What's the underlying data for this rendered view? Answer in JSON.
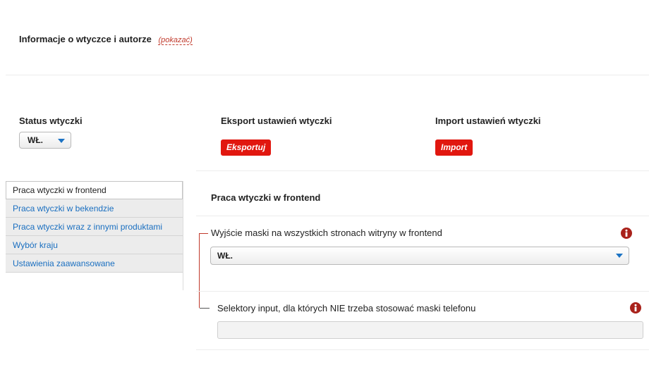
{
  "plugin_info": {
    "title": "Informacje o wtyczce i autorze",
    "toggle_link": "(pokazać)"
  },
  "status": {
    "label": "Status wtyczki",
    "selected": "WŁ."
  },
  "export": {
    "label": "Eksport ustawień wtyczki",
    "button": "Eksportuj"
  },
  "import": {
    "label": "Import ustawień wtyczki",
    "button": "Import"
  },
  "sidebar": {
    "items": [
      {
        "label": "Praca wtyczki w frontend",
        "active": true
      },
      {
        "label": "Praca wtyczki w bekendzie",
        "active": false
      },
      {
        "label": "Praca wtyczki wraz z innymi produktami",
        "active": false
      },
      {
        "label": "Wybór kraju",
        "active": false
      },
      {
        "label": "Ustawienia zaawansowane",
        "active": false
      }
    ]
  },
  "panel": {
    "title": "Praca wtyczki w frontend",
    "fields": [
      {
        "label": "Wyjście maski na wszystkich stronach witryny w frontend",
        "type": "select",
        "selected": "WŁ.",
        "icon": "info-icon"
      },
      {
        "label": "Selektory input, dla których NIE trzeba stosować maski telefonu",
        "type": "text",
        "value": "",
        "icon": "info-icon"
      }
    ]
  },
  "colors": {
    "accent_red": "#e1170f",
    "info_icon": "#a9221b",
    "link_blue": "#1a6fc0",
    "caret_blue": "#1c73c4"
  }
}
